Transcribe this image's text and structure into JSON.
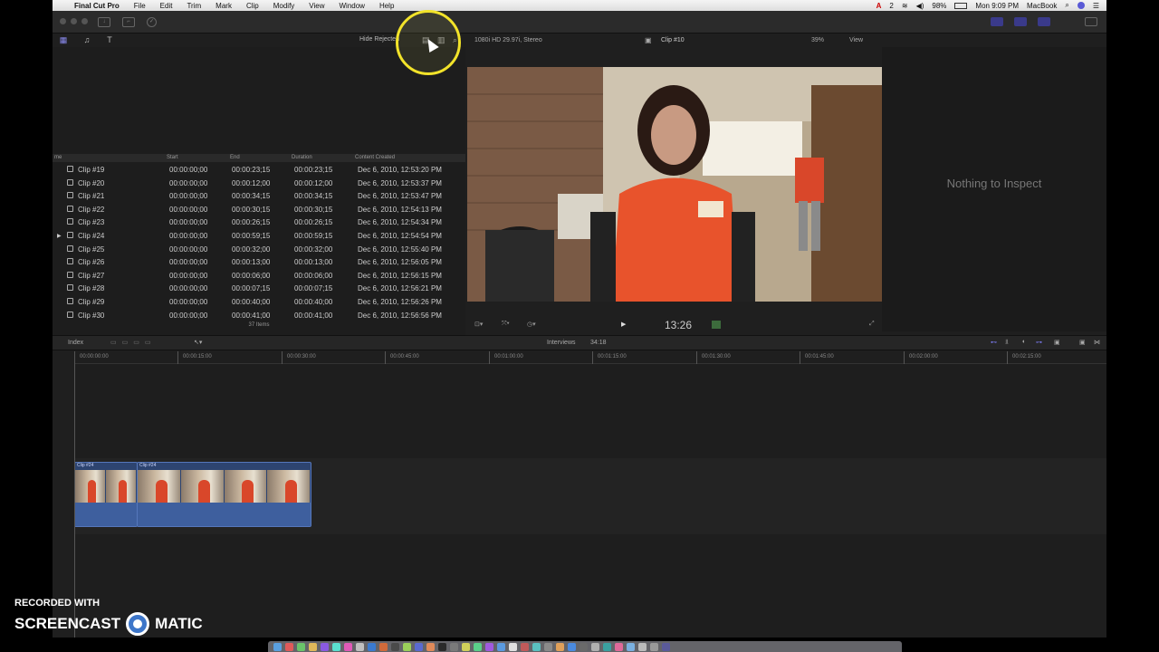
{
  "menubar": {
    "app_name": "Final Cut Pro",
    "menus": [
      "File",
      "Edit",
      "Trim",
      "Mark",
      "Clip",
      "Modify",
      "View",
      "Window",
      "Help"
    ],
    "adobe_count": "2",
    "battery": "98%",
    "clock": "Mon 9:09 PM",
    "user": "MacBook"
  },
  "browser_toolbar": {
    "filter_label": "Hide Rejected"
  },
  "browser": {
    "columns": [
      "me",
      "Start",
      "End",
      "Duration",
      "Content Created"
    ],
    "rows": [
      {
        "name": "Clip #19",
        "start": "00:00:00;00",
        "end": "00:00:23;15",
        "duration": "00:00:23;15",
        "created": "Dec 6, 2010, 12:53:20 PM"
      },
      {
        "name": "Clip #20",
        "start": "00:00:00;00",
        "end": "00:00:12;00",
        "duration": "00:00:12;00",
        "created": "Dec 6, 2010, 12:53:37 PM"
      },
      {
        "name": "Clip #21",
        "start": "00:00:00;00",
        "end": "00:00:34;15",
        "duration": "00:00:34;15",
        "created": "Dec 6, 2010, 12:53:47 PM"
      },
      {
        "name": "Clip #22",
        "start": "00:00:00;00",
        "end": "00:00:30;15",
        "duration": "00:00:30;15",
        "created": "Dec 6, 2010, 12:54:13 PM"
      },
      {
        "name": "Clip #23",
        "start": "00:00:00;00",
        "end": "00:00:26;15",
        "duration": "00:00:26;15",
        "created": "Dec 6, 2010, 12:54:34 PM"
      },
      {
        "name": "Clip #24",
        "start": "00:00:00;00",
        "end": "00:00:59;15",
        "duration": "00:00:59;15",
        "created": "Dec 6, 2010, 12:54:54 PM",
        "expanded": true
      },
      {
        "name": "Clip #25",
        "start": "00:00:00;00",
        "end": "00:00:32;00",
        "duration": "00:00:32;00",
        "created": "Dec 6, 2010, 12:55:40 PM"
      },
      {
        "name": "Clip #26",
        "start": "00:00:00;00",
        "end": "00:00:13;00",
        "duration": "00:00:13;00",
        "created": "Dec 6, 2010, 12:56:05 PM"
      },
      {
        "name": "Clip #27",
        "start": "00:00:00;00",
        "end": "00:00:06;00",
        "duration": "00:00:06;00",
        "created": "Dec 6, 2010, 12:56:15 PM"
      },
      {
        "name": "Clip #28",
        "start": "00:00:00;00",
        "end": "00:00:07;15",
        "duration": "00:00:07;15",
        "created": "Dec 6, 2010, 12:56:21 PM"
      },
      {
        "name": "Clip #29",
        "start": "00:00:00;00",
        "end": "00:00:40;00",
        "duration": "00:00:40;00",
        "created": "Dec 6, 2010, 12:56:26 PM"
      },
      {
        "name": "Clip #30",
        "start": "00:00:00;00",
        "end": "00:00:41;00",
        "duration": "00:00:41;00",
        "created": "Dec 6, 2010, 12:56:56 PM"
      }
    ],
    "item_count": "37 Items"
  },
  "viewer": {
    "format": "1080i HD 29.97i, Stereo",
    "clip_name": "Clip #10",
    "zoom": "39%",
    "view_menu": "View",
    "timecode": "13:26"
  },
  "inspector": {
    "message": "Nothing to Inspect"
  },
  "timeline": {
    "index_label": "Index",
    "project_name": "Interviews",
    "project_duration": "34:18",
    "ruler": [
      "00:00:00:00",
      "00:00:15:00",
      "00:00:30:00",
      "00:00:45:00",
      "00:01:00:00",
      "00:01:15:00",
      "00:01:30:00",
      "00:01:45:00",
      "00:02:00:00",
      "00:02:15:00"
    ],
    "clips": [
      {
        "label": "Clip #24"
      },
      {
        "label": "Clip #24"
      }
    ]
  },
  "watermark": {
    "line1": "RECORDED WITH",
    "brand_left": "SCREENCAST",
    "brand_right": "MATIC"
  },
  "colors": {
    "accent_purple": "#8a8aee",
    "clip_blue": "#2d4470",
    "cursor_ring": "#f2e32a"
  }
}
